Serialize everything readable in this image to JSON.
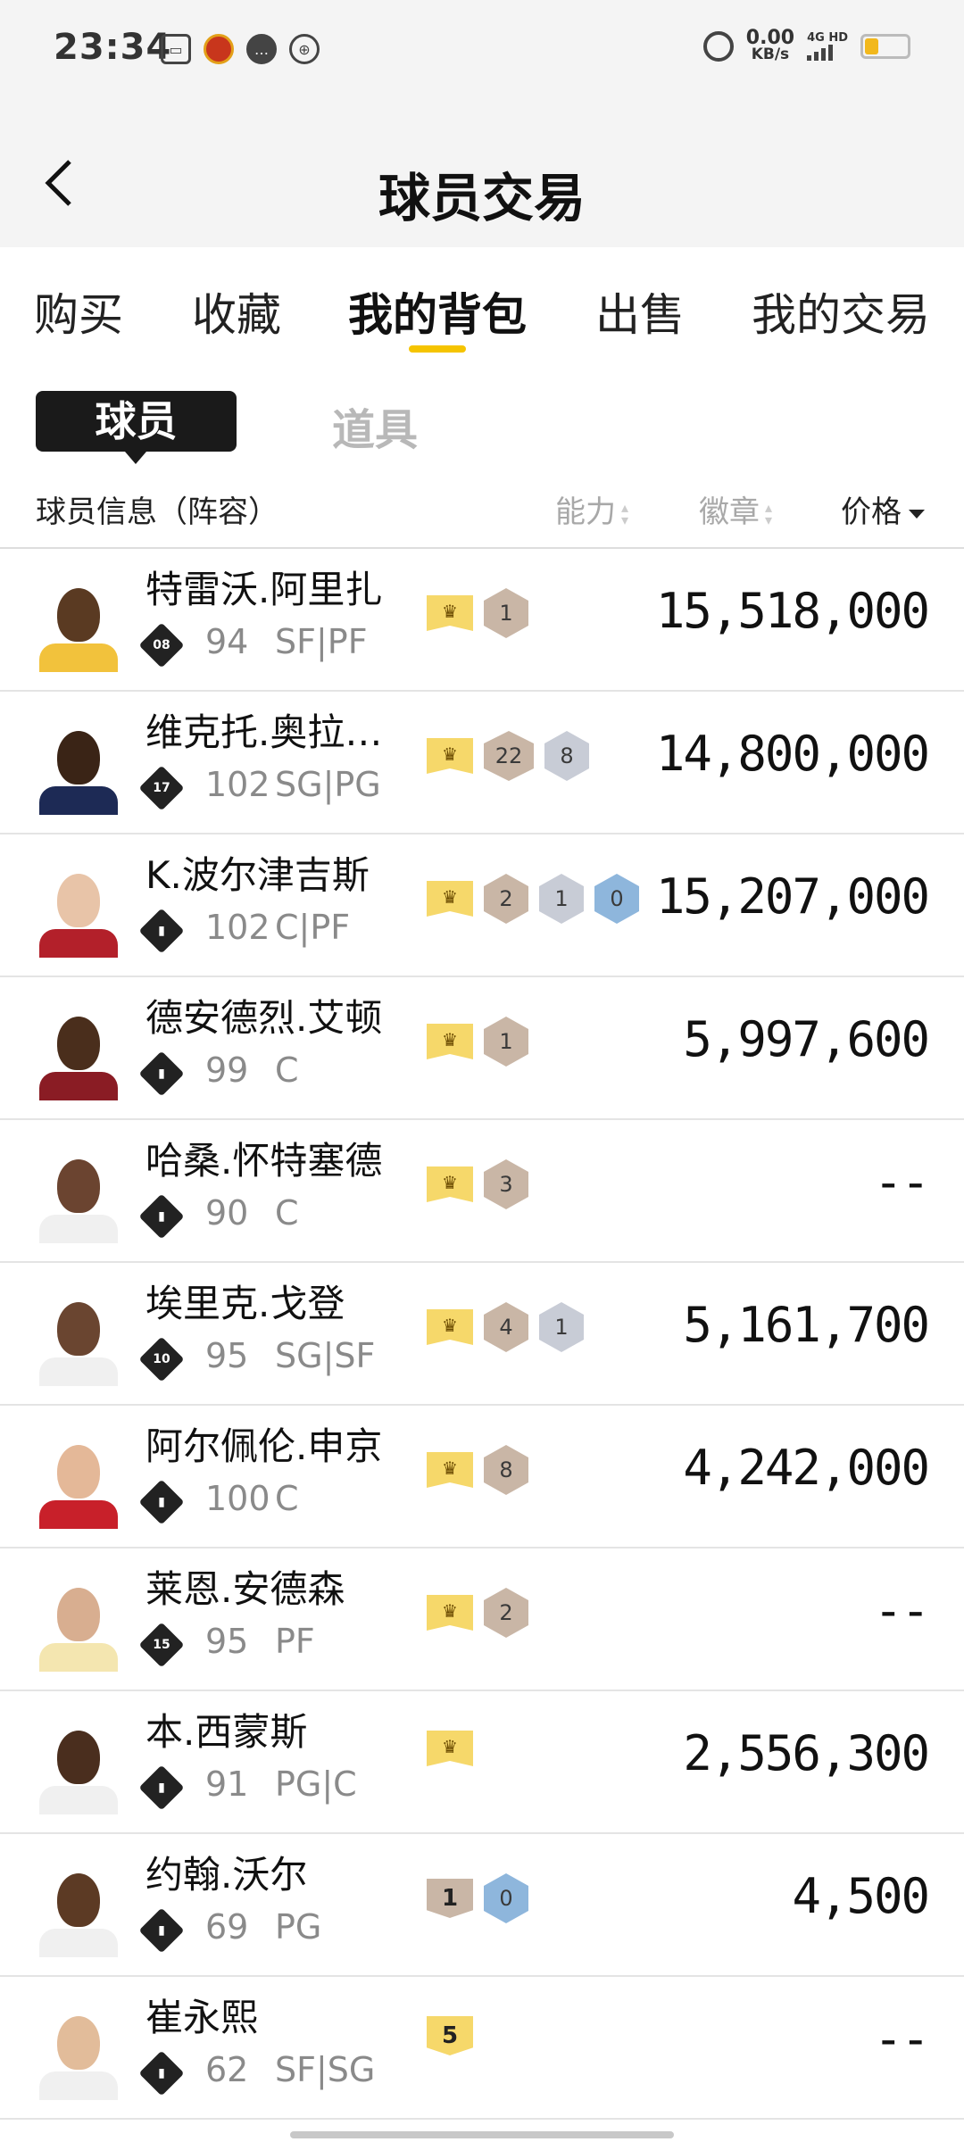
{
  "status_bar": {
    "time": "23:34",
    "speed_value": "0.00",
    "speed_unit": "KB/s",
    "network": "4G HD"
  },
  "header": {
    "title": "球员交易"
  },
  "tabs": [
    {
      "label": "购买"
    },
    {
      "label": "收藏"
    },
    {
      "label": "我的背包",
      "active": true
    },
    {
      "label": "出售"
    },
    {
      "label": "我的交易"
    }
  ],
  "subtabs": {
    "active": "球员",
    "other": "道具"
  },
  "columns": {
    "info": "球员信息（阵容）",
    "ability": "能力",
    "badge": "徽章",
    "price": "价格"
  },
  "players": [
    {
      "name": "特雷沃.阿里扎",
      "tier": "08",
      "ovr": "94",
      "pos": "SF|PF",
      "badges": [
        {
          "type": "crown"
        },
        {
          "type": "bronze",
          "n": "1"
        }
      ],
      "price": "15,518,000"
    },
    {
      "name": "维克托.奥拉…",
      "tier": "17",
      "ovr": "102",
      "pos": "SG|PG",
      "badges": [
        {
          "type": "crown"
        },
        {
          "type": "bronze",
          "n": "22"
        },
        {
          "type": "silver",
          "n": "8"
        }
      ],
      "price": "14,800,000"
    },
    {
      "name": "K.波尔津吉斯",
      "tier": "",
      "ovr": "102",
      "pos": "C|PF",
      "badges": [
        {
          "type": "crown"
        },
        {
          "type": "bronze",
          "n": "2"
        },
        {
          "type": "silver",
          "n": "1"
        },
        {
          "type": "blue",
          "n": "0"
        }
      ],
      "price": "15,207,000"
    },
    {
      "name": "德安德烈.艾顿",
      "tier": "",
      "ovr": "99",
      "pos": "C",
      "badges": [
        {
          "type": "crown"
        },
        {
          "type": "bronze",
          "n": "1"
        }
      ],
      "price": "5,997,600"
    },
    {
      "name": "哈桑.怀特塞德",
      "tier": "",
      "ovr": "90",
      "pos": "C",
      "badges": [
        {
          "type": "crown"
        },
        {
          "type": "bronze",
          "n": "3"
        }
      ],
      "price": "--"
    },
    {
      "name": "埃里克.戈登",
      "tier": "10",
      "ovr": "95",
      "pos": "SG|SF",
      "badges": [
        {
          "type": "crown"
        },
        {
          "type": "bronze",
          "n": "4"
        },
        {
          "type": "silver",
          "n": "1"
        }
      ],
      "price": "5,161,700"
    },
    {
      "name": "阿尔佩伦.申京",
      "tier": "",
      "ovr": "100",
      "pos": "C",
      "badges": [
        {
          "type": "crown"
        },
        {
          "type": "bronze",
          "n": "8"
        }
      ],
      "price": "4,242,000"
    },
    {
      "name": "莱恩.安德森",
      "tier": "15",
      "ovr": "95",
      "pos": "PF",
      "badges": [
        {
          "type": "crown"
        },
        {
          "type": "bronze",
          "n": "2"
        }
      ],
      "price": "--"
    },
    {
      "name": "本.西蒙斯",
      "tier": "",
      "ovr": "91",
      "pos": "PG|C",
      "badges": [
        {
          "type": "crown"
        }
      ],
      "price": "2,556,300"
    },
    {
      "name": "约翰.沃尔",
      "tier": "",
      "ovr": "69",
      "pos": "PG",
      "badges": [
        {
          "type": "plate",
          "n": "1"
        },
        {
          "type": "blue",
          "n": "0"
        }
      ],
      "price": "4,500"
    },
    {
      "name": "崔永熙",
      "tier": "",
      "ovr": "62",
      "pos": "SF|SG",
      "badges": [
        {
          "type": "plate-gold",
          "n": "5"
        }
      ],
      "price": "--"
    }
  ],
  "colors": {
    "accent": "#f5c400",
    "crown": "#f6d86a",
    "bronze": "#c9b6a6",
    "silver": "#c8ccd6",
    "blue": "#8eb6dc"
  }
}
